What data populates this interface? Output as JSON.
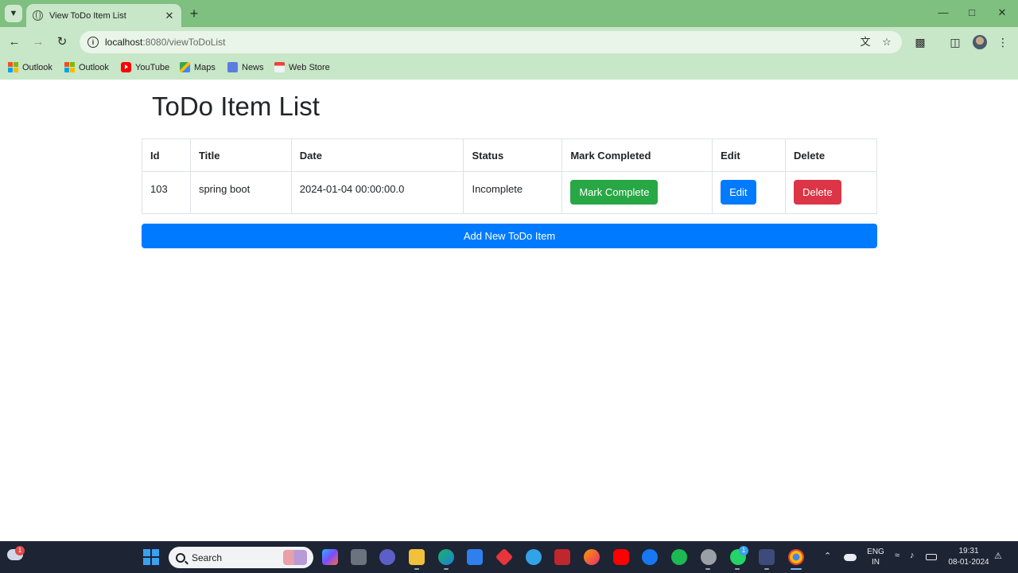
{
  "browser": {
    "tab_title": "View ToDo Item List",
    "url_host": "localhost",
    "url_path": ":8080/viewToDoList",
    "bookmarks": [
      {
        "label": "Outlook",
        "icon": "windows-icon"
      },
      {
        "label": "Outlook",
        "icon": "windows-icon"
      },
      {
        "label": "YouTube",
        "icon": "youtube-icon"
      },
      {
        "label": "Maps",
        "icon": "maps-icon"
      },
      {
        "label": "News",
        "icon": "news-icon"
      },
      {
        "label": "Web Store",
        "icon": "web-store-icon"
      }
    ]
  },
  "page": {
    "title": "ToDo Item List",
    "table": {
      "headers": [
        "Id",
        "Title",
        "Date",
        "Status",
        "Mark Completed",
        "Edit",
        "Delete"
      ],
      "rows": [
        {
          "id": "103",
          "title": "spring boot",
          "date": "2024-01-04 00:00:00.0",
          "status": "Incomplete",
          "mark_label": "Mark Complete",
          "edit_label": "Edit",
          "delete_label": "Delete"
        }
      ]
    },
    "add_button": "Add New ToDo Item"
  },
  "colors": {
    "mark_complete": "#28a745",
    "edit": "#007bff",
    "delete": "#dc3545",
    "add": "#007bff",
    "chrome_theme": "#c8e6c8"
  },
  "taskbar": {
    "search_label": "Search",
    "weather_badge": "1",
    "whatsapp_badge": "1",
    "language_line1": "ENG",
    "language_line2": "IN",
    "time": "19:31",
    "date": "08-01-2024"
  }
}
